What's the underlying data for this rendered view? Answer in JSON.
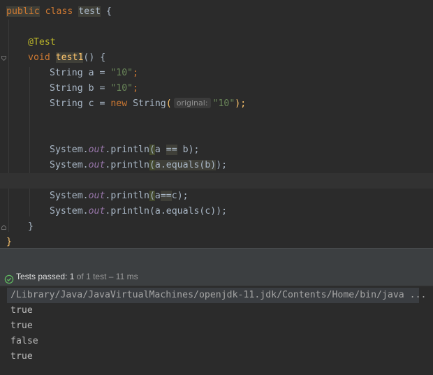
{
  "editor": {
    "class_decl": {
      "kw_public": "public",
      "kw_class": "class",
      "name": "test",
      "brace": "{"
    },
    "annotation": "@Test",
    "method_decl": {
      "kw_void": "void",
      "name": "test1",
      "suffix": "() {"
    },
    "line_a": {
      "prefix": "String a = ",
      "value": "\"10\"",
      "semi": ";"
    },
    "line_b": {
      "prefix": "String b = ",
      "value": "\"10\"",
      "semi": ";"
    },
    "line_c": {
      "prefix": "String c = ",
      "kw_new": "new",
      "type": " String",
      "lparen": "(",
      "hint": "original:",
      "value": "\"10\"",
      "end": ");"
    },
    "println1": {
      "sys": "System.",
      "out": "out",
      "call": ".println",
      "lparen": "(",
      "arg_pre": "a ",
      "op": "==",
      "arg_post": " b",
      "end": ");"
    },
    "println2": {
      "sys": "System.",
      "out": "out",
      "call": ".println",
      "lparen": "(",
      "arg": "a.equals(b)",
      "end": ");"
    },
    "println3": {
      "sys": "System.",
      "out": "out",
      "call": ".println",
      "lparen": "(",
      "arg_pre": "a",
      "op": "==",
      "arg_post": "c",
      "end": ");"
    },
    "println4": {
      "sys": "System.",
      "out": "out",
      "call": ".println",
      "arg": "(a.equals(c));"
    },
    "method_close": "}",
    "class_close": "}"
  },
  "test_bar": {
    "status_label": "Tests passed:",
    "passed": "1",
    "summary": "of 1 test – 11 ms"
  },
  "console": {
    "command": "/Library/Java/JavaVirtualMachines/openjdk-11.jdk/Contents/Home/bin/java ...",
    "output": [
      "true",
      "true",
      "false",
      "true"
    ]
  },
  "colors": {
    "keyword": "#cc7832",
    "string": "#6a8759",
    "annotation": "#bbb529",
    "static_field": "#9876aa",
    "method_name": "#ffc66d",
    "success": "#5fb85f"
  }
}
